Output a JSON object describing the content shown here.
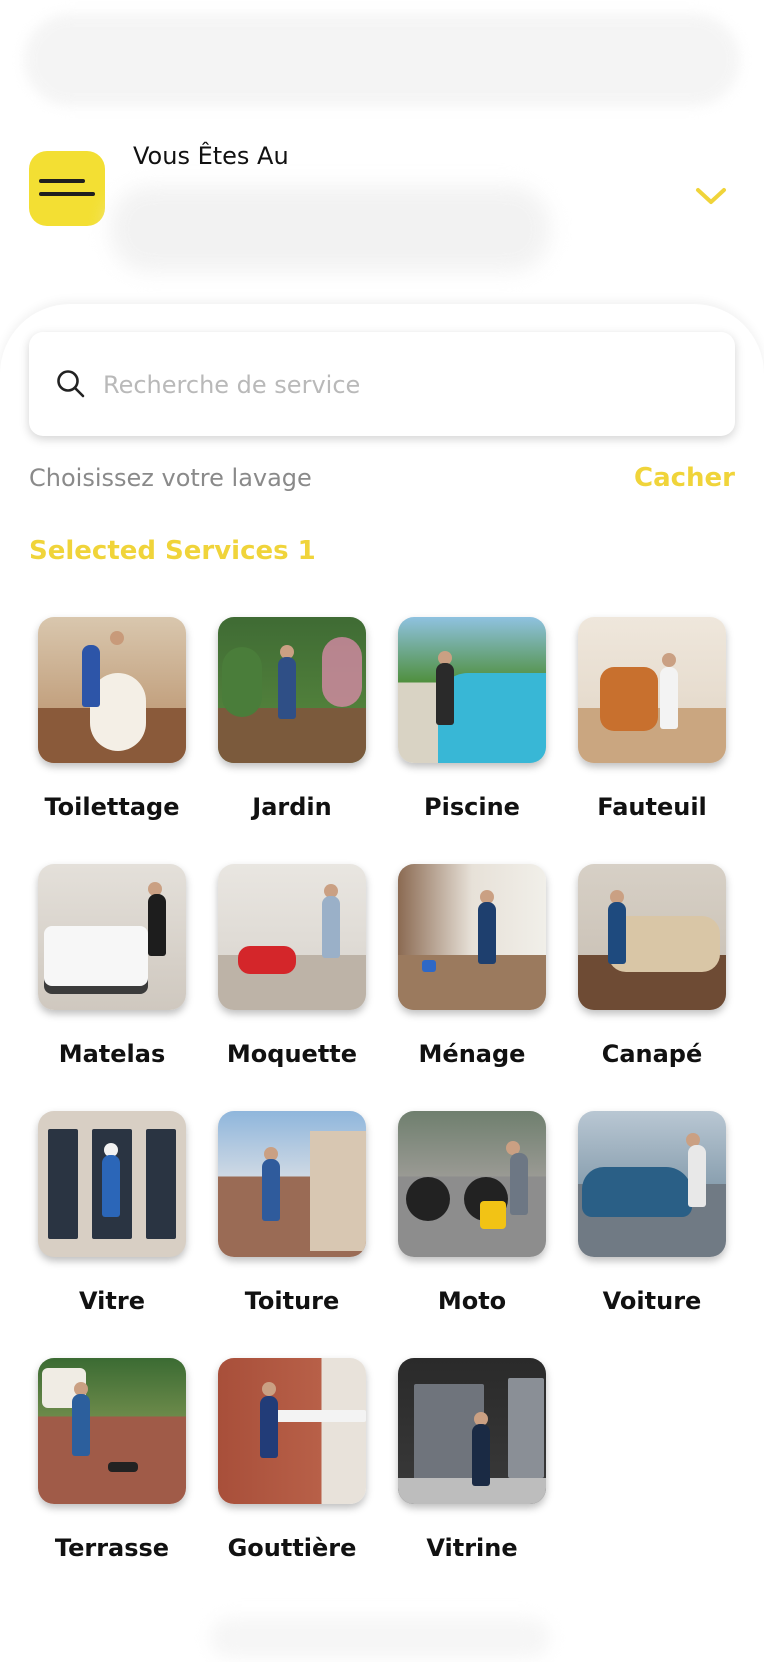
{
  "header": {
    "location_label": "Vous Êtes Au",
    "location_value": ""
  },
  "search": {
    "placeholder": "Recherche de service",
    "value": ""
  },
  "section": {
    "choose_label": "Choisissez votre lavage",
    "hide_label": "Cacher",
    "selected_label": "Selected Services 1"
  },
  "colors": {
    "accent": "#f3df33",
    "accent_text": "#f0d43a"
  },
  "services": [
    {
      "label": "Toilettage",
      "image": "grooming-dog-photo"
    },
    {
      "label": "Jardin",
      "image": "garden-photo"
    },
    {
      "label": "Piscine",
      "image": "pool-photo"
    },
    {
      "label": "Fauteuil",
      "image": "armchair-photo"
    },
    {
      "label": "Matelas",
      "image": "mattress-photo"
    },
    {
      "label": "Moquette",
      "image": "carpet-photo"
    },
    {
      "label": "Ménage",
      "image": "housekeeping-photo"
    },
    {
      "label": "Canapé",
      "image": "sofa-photo"
    },
    {
      "label": "Vitre",
      "image": "window-photo"
    },
    {
      "label": "Toiture",
      "image": "roof-photo"
    },
    {
      "label": "Moto",
      "image": "motorcycle-photo"
    },
    {
      "label": "Voiture",
      "image": "car-photo"
    },
    {
      "label": "Terrasse",
      "image": "terrace-photo"
    },
    {
      "label": "Gouttière",
      "image": "gutter-photo"
    },
    {
      "label": "Vitrine",
      "image": "shopfront-photo"
    }
  ]
}
